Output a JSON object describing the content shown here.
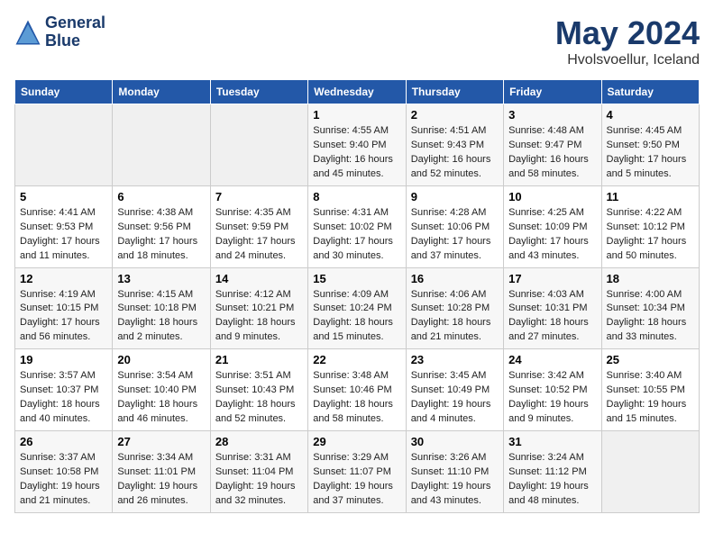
{
  "header": {
    "logo_line1": "General",
    "logo_line2": "Blue",
    "month": "May 2024",
    "location": "Hvolsvoellur, Iceland"
  },
  "days_of_week": [
    "Sunday",
    "Monday",
    "Tuesday",
    "Wednesday",
    "Thursday",
    "Friday",
    "Saturday"
  ],
  "weeks": [
    [
      {
        "day": "",
        "info": ""
      },
      {
        "day": "",
        "info": ""
      },
      {
        "day": "",
        "info": ""
      },
      {
        "day": "1",
        "info": "Sunrise: 4:55 AM\nSunset: 9:40 PM\nDaylight: 16 hours and 45 minutes."
      },
      {
        "day": "2",
        "info": "Sunrise: 4:51 AM\nSunset: 9:43 PM\nDaylight: 16 hours and 52 minutes."
      },
      {
        "day": "3",
        "info": "Sunrise: 4:48 AM\nSunset: 9:47 PM\nDaylight: 16 hours and 58 minutes."
      },
      {
        "day": "4",
        "info": "Sunrise: 4:45 AM\nSunset: 9:50 PM\nDaylight: 17 hours and 5 minutes."
      }
    ],
    [
      {
        "day": "5",
        "info": "Sunrise: 4:41 AM\nSunset: 9:53 PM\nDaylight: 17 hours and 11 minutes."
      },
      {
        "day": "6",
        "info": "Sunrise: 4:38 AM\nSunset: 9:56 PM\nDaylight: 17 hours and 18 minutes."
      },
      {
        "day": "7",
        "info": "Sunrise: 4:35 AM\nSunset: 9:59 PM\nDaylight: 17 hours and 24 minutes."
      },
      {
        "day": "8",
        "info": "Sunrise: 4:31 AM\nSunset: 10:02 PM\nDaylight: 17 hours and 30 minutes."
      },
      {
        "day": "9",
        "info": "Sunrise: 4:28 AM\nSunset: 10:06 PM\nDaylight: 17 hours and 37 minutes."
      },
      {
        "day": "10",
        "info": "Sunrise: 4:25 AM\nSunset: 10:09 PM\nDaylight: 17 hours and 43 minutes."
      },
      {
        "day": "11",
        "info": "Sunrise: 4:22 AM\nSunset: 10:12 PM\nDaylight: 17 hours and 50 minutes."
      }
    ],
    [
      {
        "day": "12",
        "info": "Sunrise: 4:19 AM\nSunset: 10:15 PM\nDaylight: 17 hours and 56 minutes."
      },
      {
        "day": "13",
        "info": "Sunrise: 4:15 AM\nSunset: 10:18 PM\nDaylight: 18 hours and 2 minutes."
      },
      {
        "day": "14",
        "info": "Sunrise: 4:12 AM\nSunset: 10:21 PM\nDaylight: 18 hours and 9 minutes."
      },
      {
        "day": "15",
        "info": "Sunrise: 4:09 AM\nSunset: 10:24 PM\nDaylight: 18 hours and 15 minutes."
      },
      {
        "day": "16",
        "info": "Sunrise: 4:06 AM\nSunset: 10:28 PM\nDaylight: 18 hours and 21 minutes."
      },
      {
        "day": "17",
        "info": "Sunrise: 4:03 AM\nSunset: 10:31 PM\nDaylight: 18 hours and 27 minutes."
      },
      {
        "day": "18",
        "info": "Sunrise: 4:00 AM\nSunset: 10:34 PM\nDaylight: 18 hours and 33 minutes."
      }
    ],
    [
      {
        "day": "19",
        "info": "Sunrise: 3:57 AM\nSunset: 10:37 PM\nDaylight: 18 hours and 40 minutes."
      },
      {
        "day": "20",
        "info": "Sunrise: 3:54 AM\nSunset: 10:40 PM\nDaylight: 18 hours and 46 minutes."
      },
      {
        "day": "21",
        "info": "Sunrise: 3:51 AM\nSunset: 10:43 PM\nDaylight: 18 hours and 52 minutes."
      },
      {
        "day": "22",
        "info": "Sunrise: 3:48 AM\nSunset: 10:46 PM\nDaylight: 18 hours and 58 minutes."
      },
      {
        "day": "23",
        "info": "Sunrise: 3:45 AM\nSunset: 10:49 PM\nDaylight: 19 hours and 4 minutes."
      },
      {
        "day": "24",
        "info": "Sunrise: 3:42 AM\nSunset: 10:52 PM\nDaylight: 19 hours and 9 minutes."
      },
      {
        "day": "25",
        "info": "Sunrise: 3:40 AM\nSunset: 10:55 PM\nDaylight: 19 hours and 15 minutes."
      }
    ],
    [
      {
        "day": "26",
        "info": "Sunrise: 3:37 AM\nSunset: 10:58 PM\nDaylight: 19 hours and 21 minutes."
      },
      {
        "day": "27",
        "info": "Sunrise: 3:34 AM\nSunset: 11:01 PM\nDaylight: 19 hours and 26 minutes."
      },
      {
        "day": "28",
        "info": "Sunrise: 3:31 AM\nSunset: 11:04 PM\nDaylight: 19 hours and 32 minutes."
      },
      {
        "day": "29",
        "info": "Sunrise: 3:29 AM\nSunset: 11:07 PM\nDaylight: 19 hours and 37 minutes."
      },
      {
        "day": "30",
        "info": "Sunrise: 3:26 AM\nSunset: 11:10 PM\nDaylight: 19 hours and 43 minutes."
      },
      {
        "day": "31",
        "info": "Sunrise: 3:24 AM\nSunset: 11:12 PM\nDaylight: 19 hours and 48 minutes."
      },
      {
        "day": "",
        "info": ""
      }
    ]
  ]
}
